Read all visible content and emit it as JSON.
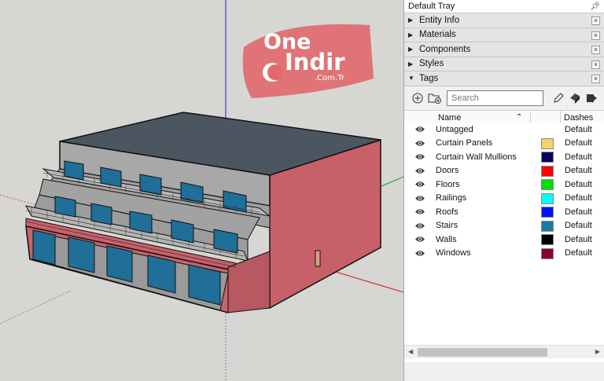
{
  "watermark": {
    "word1": "One",
    "word2": "Indir",
    "domain": ".Com.Tr"
  },
  "tray": {
    "title": "Default Tray",
    "panels": [
      {
        "label": "Entity Info",
        "expanded": false
      },
      {
        "label": "Materials",
        "expanded": false
      },
      {
        "label": "Components",
        "expanded": false
      },
      {
        "label": "Styles",
        "expanded": false
      },
      {
        "label": "Tags",
        "expanded": true
      }
    ]
  },
  "tags": {
    "search_placeholder": "Search",
    "columns": {
      "name": "Name",
      "dashes": "Dashes"
    },
    "items": [
      {
        "name": "Untagged",
        "color": "",
        "dashes": "Default"
      },
      {
        "name": "Curtain Panels",
        "color": "#f4d36c",
        "dashes": "Default"
      },
      {
        "name": "Curtain Wall Mullions",
        "color": "#080060",
        "dashes": "Default"
      },
      {
        "name": "Doors",
        "color": "#ff0000",
        "dashes": "Default"
      },
      {
        "name": "Floors",
        "color": "#00e000",
        "dashes": "Default"
      },
      {
        "name": "Railings",
        "color": "#00ffff",
        "dashes": "Default"
      },
      {
        "name": "Roofs",
        "color": "#0010ff",
        "dashes": "Default"
      },
      {
        "name": "Stairs",
        "color": "#1a7aa6",
        "dashes": "Default"
      },
      {
        "name": "Walls",
        "color": "#000000",
        "dashes": "Default"
      },
      {
        "name": "Windows",
        "color": "#8a0038",
        "dashes": "Default"
      }
    ]
  }
}
